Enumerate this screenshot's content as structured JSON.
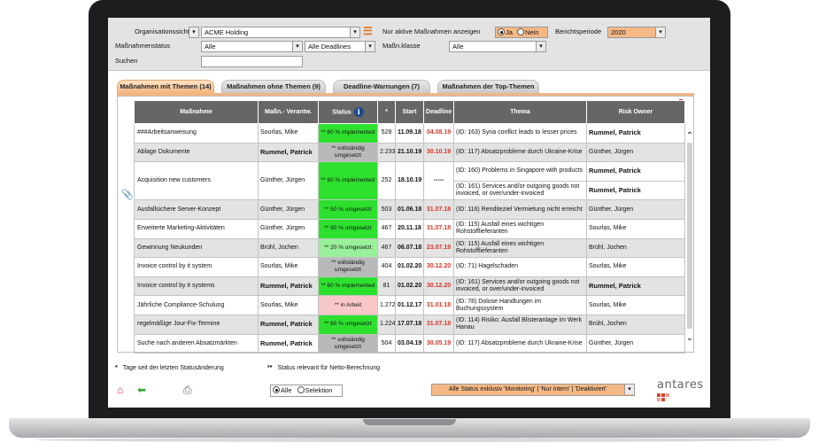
{
  "filters": {
    "org_label": "Organisationssicht",
    "org_value": "ACME Holding",
    "active_label": "Nur aktive Maßnahmen anzeigen",
    "yes": "Ja",
    "no": "Nein",
    "active_selected": "Ja",
    "period_label": "Berichtsperiode",
    "period_value": "2020",
    "status_label": "Maßnahmenstatus",
    "status_value": "Alle",
    "deadline_value": "Alle Deadlines",
    "class_label": "Maßn.klasse",
    "class_value": "Alle",
    "search_label": "Suchen",
    "search_value": ""
  },
  "tabs": [
    {
      "label": "Maßnahmen mit Themen (14)",
      "active": true
    },
    {
      "label": "Maßnahmen ohne Themen (9)",
      "active": false
    },
    {
      "label": "Deadline-Warnungen (7)",
      "active": false
    },
    {
      "label": "Maßnahmen der Top-Themen",
      "active": false
    }
  ],
  "table": {
    "headers": {
      "measure": "Maßnahme",
      "owner": "Maßn.- Verantw.",
      "status": "Status",
      "star": "*",
      "start": "Start",
      "deadline": "Deadline",
      "topic": "Thema",
      "risk_owner": "Risk Owner"
    },
    "rows": [
      {
        "measure": "###Arbeitsanweisung",
        "owner": "Sourlas, Mike",
        "owner_bold": false,
        "status": "** 60 % implemented",
        "status_color": "green",
        "days": "528",
        "start": "11.09.18",
        "deadline": "04.08.19",
        "deadline_red": true,
        "topic": "(ID: 163) Syria conflict leads to lesser prices",
        "risk_owner": "Rummel, Patrick",
        "risk_bold": true,
        "shaded": false
      },
      {
        "measure": "Ablage Dokumente",
        "owner": "Rummel, Patrick",
        "owner_bold": true,
        "status": "** vollständig umgesetzt",
        "status_color": "gray",
        "days": "2.233",
        "start": "21.10.19",
        "deadline": "30.10.19",
        "deadline_red": true,
        "topic": "(ID: 117) Absatzprobleme durch Ukraine-Krise",
        "risk_owner": "Günther, Jürgen",
        "risk_bold": false,
        "shaded": true
      },
      {
        "measure": "Acquisition new customers",
        "owner": "Günther, Jürgen",
        "owner_bold": false,
        "status": "** 60 % implemented",
        "status_color": "green",
        "days": "252",
        "start": "18.10.19",
        "deadline": "-----",
        "deadline_red": false,
        "topic": "(ID: 160) Problems in Singapore with products",
        "risk_owner": "Rummel, Patrick",
        "risk_bold": true,
        "shaded": false
      },
      {
        "measure": "",
        "owner": "",
        "owner_bold": false,
        "status": "",
        "status_color": "none",
        "days": "",
        "start": "",
        "deadline": "",
        "deadline_red": false,
        "topic": "(ID: 161) Services and/or outgoing goods not invoiced, or over/under-invoiced",
        "risk_owner": "Rummel, Patrick",
        "risk_bold": true,
        "shaded": false,
        "continuation": true
      },
      {
        "measure": "Ausfallsichere Server-Konzept",
        "owner": "Günther, Jürgen",
        "owner_bold": false,
        "status": "** 50 % umgesetzt",
        "status_color": "green",
        "days": "503",
        "start": "01.06.18",
        "deadline": "31.07.18",
        "deadline_red": true,
        "topic": "(ID: 116) Renditeziel Vermietung nicht erreicht",
        "risk_owner": "Günther, Jürgen",
        "risk_bold": false,
        "shaded": true
      },
      {
        "measure": "Erweiterte Marketing-Aktivitäten",
        "owner": "Günther, Jürgen",
        "owner_bold": false,
        "status": "** 90 % umgesetzt",
        "status_color": "green",
        "days": "467",
        "start": "20.11.18",
        "deadline": "31.07.18",
        "deadline_red": true,
        "topic": "(ID: 115) Ausfall eines wichtigen Rohstofflieferanten",
        "risk_owner": "Sourlas, Mike",
        "risk_bold": false,
        "shaded": false
      },
      {
        "measure": "Gewinnung Neukunden",
        "owner": "Brühl, Jochen",
        "owner_bold": false,
        "status": "** 20 % umgesetzt",
        "status_color": "lgreen",
        "days": "467",
        "start": "06.07.18",
        "deadline": "23.07.19",
        "deadline_red": true,
        "topic": "(ID: 115) Ausfall eines wichtigen Rohstofflieferanten",
        "risk_owner": "Brühl, Jochen",
        "risk_bold": false,
        "shaded": true
      },
      {
        "measure": "Invoice control by it system",
        "owner": "Sourlas, Mike",
        "owner_bold": false,
        "status": "** vollständig umgesetzt",
        "status_color": "gray",
        "days": "404",
        "start": "01.02.20",
        "deadline": "30.12.20",
        "deadline_red": true,
        "topic": "(ID: 71) Hagelschaden",
        "risk_owner": "Sourlas, Mike",
        "risk_bold": false,
        "shaded": false
      },
      {
        "measure": "Invoice control by it systems",
        "owner": "Rummel, Patrick",
        "owner_bold": true,
        "status": "** 60 % implemented",
        "status_color": "green",
        "days": "81",
        "start": "01.02.20",
        "deadline": "30.12.20",
        "deadline_red": true,
        "topic": "(ID: 161) Services and/or outgoing goods not invoiced, or over/under-invoiced",
        "risk_owner": "Rummel, Patrick",
        "risk_bold": true,
        "shaded": true
      },
      {
        "measure": "Jährliche Compliance-Schulung",
        "owner": "Sourlas, Mike",
        "owner_bold": false,
        "status": "** in Arbeit",
        "status_color": "pink",
        "days": "1.272",
        "start": "01.12.17",
        "deadline": "31.01.18",
        "deadline_red": true,
        "topic": "(ID: 78) Dolose Handlungen im Buchungssystem",
        "risk_owner": "Sourlas, Mike",
        "risk_bold": false,
        "shaded": false
      },
      {
        "measure": "regelmäßige Jour-Fix-Termine",
        "owner": "Rummel, Patrick",
        "owner_bold": true,
        "status": "** 60 % umgesetzt",
        "status_color": "green",
        "days": "1.224",
        "start": "17.07.18",
        "deadline": "31.07.18",
        "deadline_red": true,
        "topic": "(ID: 114) Risiko: Ausfall Blisteranlage im Werk Hanau",
        "risk_owner": "Brühl, Jochen",
        "risk_bold": false,
        "shaded": true
      },
      {
        "measure": "Suche nach anderen Absatzmärkten",
        "owner": "Rummel, Patrick",
        "owner_bold": true,
        "status": "** vollständig umgesetzt",
        "status_color": "gray",
        "days": "504",
        "start": "03.04.19",
        "deadline": "30.05.19",
        "deadline_red": true,
        "topic": "(ID: 117) Absatzprobleme durch Ukraine-Krise",
        "risk_owner": "Günther, Jürgen",
        "risk_bold": false,
        "shaded": false
      }
    ]
  },
  "legend": {
    "one_star": "*",
    "one_star_text": "Tage seit der letzten Statusänderung",
    "two_star": "**",
    "two_star_text": "Status relevant für Netto-Berechnung"
  },
  "footer": {
    "all": "Alle",
    "selection": "Selektion",
    "status_filter": "Alle Status exklusiv 'Monitoring' | 'Nur intern' | 'Deaktiviert'",
    "logo": "antares"
  },
  "colors": {
    "accent_orange": "#f5b985",
    "status_green": "#2ee02e",
    "deadline_red": "#d8362a",
    "header_gray": "#666666"
  }
}
